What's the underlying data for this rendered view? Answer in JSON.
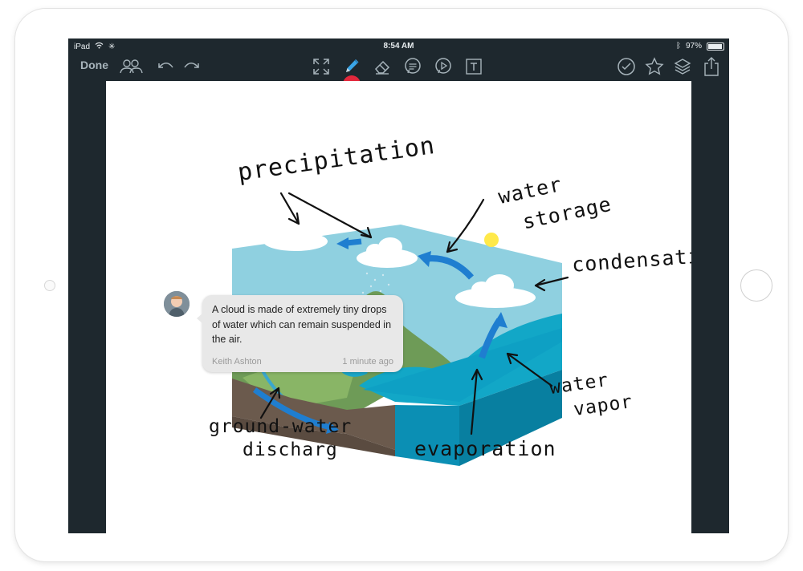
{
  "status_bar": {
    "device": "iPad",
    "time": "8:54 AM",
    "battery": "97%"
  },
  "toolbar": {
    "done_label": "Done",
    "icons": [
      "collaborators-icon",
      "undo-icon",
      "redo-icon",
      "fullscreen-icon",
      "pen-icon",
      "eraser-icon",
      "comment-icon",
      "play-icon",
      "text-icon",
      "check-icon",
      "star-icon",
      "layers-icon",
      "share-icon"
    ]
  },
  "accent_colors": {
    "pen_indicator": "#e3283c",
    "water": "#12a7c7",
    "arrow": "#1f7ed0"
  },
  "annotations": {
    "precipitation": "precipitation",
    "water_storage_1": "water",
    "water_storage_2": "storage",
    "condensation": "condensation",
    "water_vapor_1": "water",
    "water_vapor_2": "vapor",
    "evaporation": "evaporation",
    "ground_water_1": "ground-water",
    "ground_water_2": "discharg"
  },
  "comment": {
    "text": "A cloud is made of extremely tiny drops of water which can remain suspended in the air.",
    "author": "Keith Ashton",
    "time": "1 minute ago"
  }
}
